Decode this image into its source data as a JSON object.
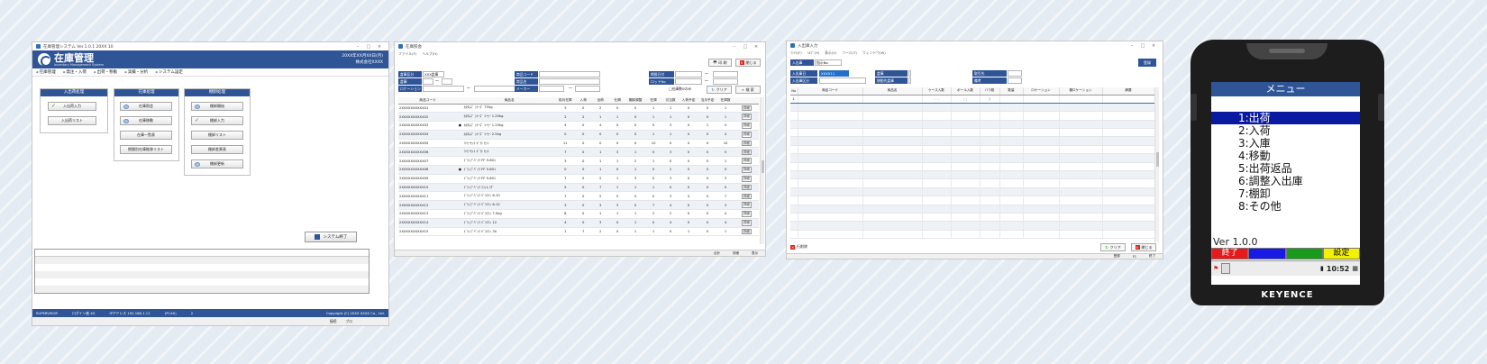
{
  "win1": {
    "title": "在庫管理システム Ver.1.0.1 20XX 10",
    "brand": "在庫管理",
    "brand_sub": "Inventory Management System",
    "date": "20XX年XX月XX日(月)",
    "user": "株式会社XXXX",
    "menu": [
      "在庫管理",
      "発注・入荷",
      "出荷・移動",
      "実績・分析",
      "システム設定"
    ],
    "group_stock": {
      "title": "入出荷処理",
      "buttons": [
        "入出荷入力",
        "入出荷リスト"
      ]
    },
    "group_inventory": {
      "title": "在庫処理",
      "buttons": [
        "在庫照会",
        "在庫移動",
        "在庫一覧表",
        "棚卸結果表",
        "期間別在庫推移リスト"
      ]
    },
    "group_master": {
      "title": "棚卸処理",
      "buttons": [
        "棚卸開始",
        "棚卸入力",
        "棚卸リスト",
        "棚卸差異表",
        "棚卸更新"
      ]
    },
    "exit_button": "システム終了",
    "status": {
      "company": "SUPERVISOR",
      "login": "ログイン者   XX",
      "ip": "IPアドレス   192.168.1.11",
      "pc": "(PCXX)",
      "num": "2",
      "copyright": "Copyright (C) 20XX XXXX Co., Ltd.",
      "bottom_a": "接続",
      "bottom_b": "ブロ"
    }
  },
  "win2": {
    "title": "在庫照会",
    "submenu": [
      "ファイル(F)",
      "ヘルプ(H)"
    ],
    "print_btn": "印 刷",
    "close_btn": "閉じる",
    "clear_btn": "クリア",
    "search_btn": "検 索",
    "labels": {
      "warehouse": "倉庫区分",
      "warehouse_val": "XXX倉庫",
      "zone": "倉庫",
      "location": "ロケーション",
      "product_code": "商品コード",
      "product_name": "商品名",
      "maker": "メーカー",
      "qty_from": "期限日付",
      "lot": "ロットNo",
      "zero_stock": "□在庫数0のみ"
    },
    "columns": [
      "商品コード",
      "",
      "商品名",
      "前月在庫",
      "入荷",
      "出荷",
      "仕損",
      "棚卸調整",
      "在庫",
      "引当数",
      "入荷予定",
      "当月予定",
      "在庫数",
      ""
    ],
    "rows": [
      [
        "2XXXXXXXXXX01",
        "",
        "ｶｽﾀﾑｽﾞ ｼﾘｰｽﾞ 750g",
        "3",
        "0",
        "2",
        "0",
        "0",
        "1",
        "1",
        "0",
        "0",
        "1",
        "詳細"
      ],
      [
        "2XXXXXXXXXX02",
        "",
        "ｶｽﾀﾑｽﾞ ｼﾘｰｽﾞ ｺｰﾋｰ 1.25kg",
        "2",
        "2",
        "1",
        "1",
        "0",
        "1",
        "1",
        "0",
        "0",
        "1",
        "詳細"
      ],
      [
        "2XXXXXXXXXX03",
        "●",
        "ｶｽﾀﾑｽﾞ ｼﾘｰｽﾞ ｺｰﾋｰ 1.25kg",
        "4",
        "0",
        "4",
        "0",
        "0",
        "0",
        "3",
        "0",
        "1",
        "4",
        "詳細"
      ],
      [
        "2XXXXXXXXXX04",
        "",
        "ｶｽﾀﾑｽﾞ ｼﾘｰｽﾞ ｺｰﾋｰ 2.5kg",
        "0",
        "0",
        "0",
        "0",
        "0",
        "1",
        "1",
        "0",
        "0",
        "4",
        "詳細"
      ],
      [
        "2XXXXXXXXXX05",
        "",
        "ｺｰﾋｰｾｯﾄ ｷﾞﾌﾄ ｾｯﾄ",
        "11",
        "0",
        "0",
        "0",
        "0",
        "10",
        "0",
        "0",
        "0",
        "10",
        "詳細"
      ],
      [
        "2XXXXXXXXXX06",
        "",
        "ｺｰﾋｰｾｯﾄ ｷﾞﾌﾄ ｾｯﾄ",
        "7",
        "0",
        "1",
        "3",
        "1",
        "5",
        "3",
        "0",
        "0",
        "5",
        "詳細"
      ],
      [
        "2XXXXXXXXXX07",
        "",
        "ﾄﾞﾘｯﾌﾟﾊﾞｯｸ FF 5-60ｺ",
        "3",
        "0",
        "1",
        "1",
        "2",
        "1",
        "0",
        "0",
        "0",
        "1",
        "詳細"
      ],
      [
        "2XXXXXXXXXX08",
        "●",
        "ﾄﾞﾘｯﾌﾟﾊﾞｯｸ FF 5-60ｺ",
        "0",
        "0",
        "1",
        "0",
        "1",
        "0",
        "2",
        "0",
        "0",
        "0",
        "詳細"
      ],
      [
        "2XXXXXXXXXX09",
        "",
        "ﾄﾞﾘｯﾌﾟﾊﾞｯｸ FF 5-60ｺ",
        "7",
        "0",
        "2",
        "1",
        "3",
        "0",
        "3",
        "0",
        "0",
        "3",
        "詳細"
      ],
      [
        "2XXXXXXXXXX10",
        "",
        "ﾄﾞﾘｯﾌﾟﾊﾞｯｸ ﾘﾌｨﾙ ﾏｸﾞ",
        "5",
        "0",
        "7",
        "1",
        "1",
        "1",
        "0",
        "0",
        "0",
        "0",
        "詳細"
      ],
      [
        "2XXXXXXXXXX11",
        "",
        "ﾄﾞﾘｯﾌﾟﾊﾞｯｸ ﾊﾞﾗｴﾃｨ 6-10",
        "7",
        "0",
        "2",
        "5",
        "0",
        "0",
        "3",
        "0",
        "0",
        "7",
        "詳細"
      ],
      [
        "2XXXXXXXXXX12",
        "",
        "ﾄﾞﾘｯﾌﾟﾊﾞｯｸ ﾊﾞﾗｴﾃｨ 6-12",
        "3",
        "0",
        "3",
        "3",
        "0",
        "7",
        "4",
        "0",
        "0",
        "3",
        "詳細"
      ],
      [
        "2XXXXXXXXXX13",
        "",
        "ﾄﾞﾘｯﾌﾟﾊﾞｯｸ ﾊﾞﾗｴﾃｨ 7.5kg",
        "8",
        "0",
        "1",
        "1",
        "1",
        "2",
        "2",
        "0",
        "0",
        "4",
        "詳細"
      ],
      [
        "2XXXXXXXXXX14",
        "",
        "ﾄﾞﾘｯﾌﾟﾊﾞｯｸ ﾊﾞﾗｴﾃｨ 12",
        "4",
        "0",
        "3",
        "0",
        "1",
        "0",
        "4",
        "0",
        "0",
        "4",
        "詳細"
      ],
      [
        "2XXXXXXXXXX15",
        "",
        "ﾄﾞﾘｯﾌﾟﾊﾞｯｸ ﾊﾞﾗｴﾃｨ 30",
        "1",
        "7",
        "2",
        "0",
        "1",
        "1",
        "0",
        "1",
        "0",
        "1",
        "詳細"
      ]
    ],
    "footer": [
      "合計",
      "詳細",
      "表示"
    ]
  },
  "win3": {
    "title": "入出庫入力",
    "submenu": [
      "ﾌｧｲﾙ(F)",
      "ﾍﾙﾌﾟ(H)",
      "表示(V)",
      "ツール(T)",
      "ウィンドウ(W)"
    ],
    "tabs": [
      "入出庫",
      "指示No"
    ],
    "search_val": "XXXX11",
    "register_btn": "登録",
    "labels": {
      "date": "入出庫日",
      "kind": "入出庫区分",
      "warehouse": "倉庫",
      "to_warehouse": "移動先倉庫",
      "partner": "取引先",
      "note": "備考"
    },
    "columns": [
      "No",
      "商品コード",
      "商品名",
      "ケース入数",
      "ボール入数",
      "バラ数",
      "数量",
      "ロケーション",
      "棚ロケーション",
      "摘要"
    ],
    "first_row_no": "1",
    "first_row_marks": [
      ". . .",
      "; ;",
      ")"
    ],
    "footer_left": "行削除",
    "clear_btn": "クリア",
    "close_btn": "閉じる",
    "status": [
      "登録",
      "F1",
      "終了"
    ]
  },
  "handheld": {
    "title": "メニュー",
    "items": [
      "1:出荷",
      "2:入荷",
      "3:入庫",
      "4:移動",
      "5:出荷返品",
      "6:調整入出庫",
      "7:棚卸",
      "8:その他"
    ],
    "version": "Ver 1.0.0",
    "fkeys": [
      "終了",
      "",
      "",
      "設定"
    ],
    "fkey_colors": [
      "#e8191b",
      "#1a1ae6",
      "#1a9a1a",
      "#f2f200"
    ],
    "clock": "10:52",
    "brand": "KEYENCE"
  }
}
